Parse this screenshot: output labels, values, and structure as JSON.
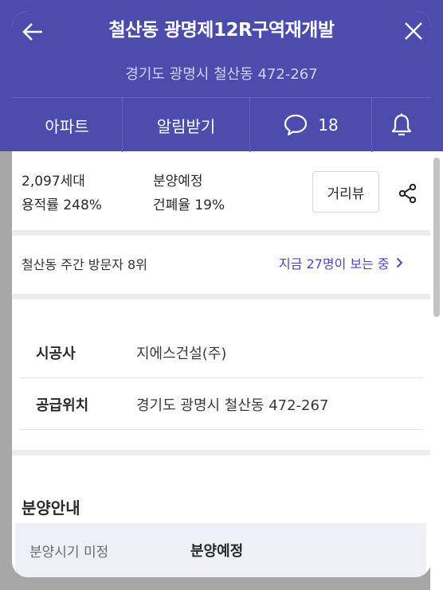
{
  "header": {
    "title": "철산동 광명제12R구역재개발",
    "address": "경기도 광명시 철산동 472-267",
    "back_icon": "arrow-left-icon",
    "close_icon": "close-icon"
  },
  "actions": {
    "apartment": "아파트",
    "notify": "알림받기",
    "comment_count": "18",
    "comment_icon": "speech-bubble-icon",
    "bell_icon": "bell-icon"
  },
  "summary": {
    "households": "2,097세대",
    "floor_area_ratio": "용적률 248%",
    "sale_status": "분양예정",
    "building_coverage": "건폐율 19%",
    "street_view_label": "거리뷰",
    "share_icon": "share-icon"
  },
  "visitors": {
    "rank": "철산동 주간 방문자 8위",
    "viewing_now": "지금 27명이 보는 중"
  },
  "info": [
    {
      "label": "시공사",
      "value": "지에스건설(주)"
    },
    {
      "label": "공급위치",
      "value": "경기도 광명시 철산동 472-267"
    }
  ],
  "sale": {
    "section_title": "분양안내",
    "period_label": "분양시기 미정",
    "status": "분양예정"
  },
  "colors": {
    "header_bg": "#4c4cad",
    "link": "#4a4ac0",
    "backdrop": "#a7a7a7"
  }
}
